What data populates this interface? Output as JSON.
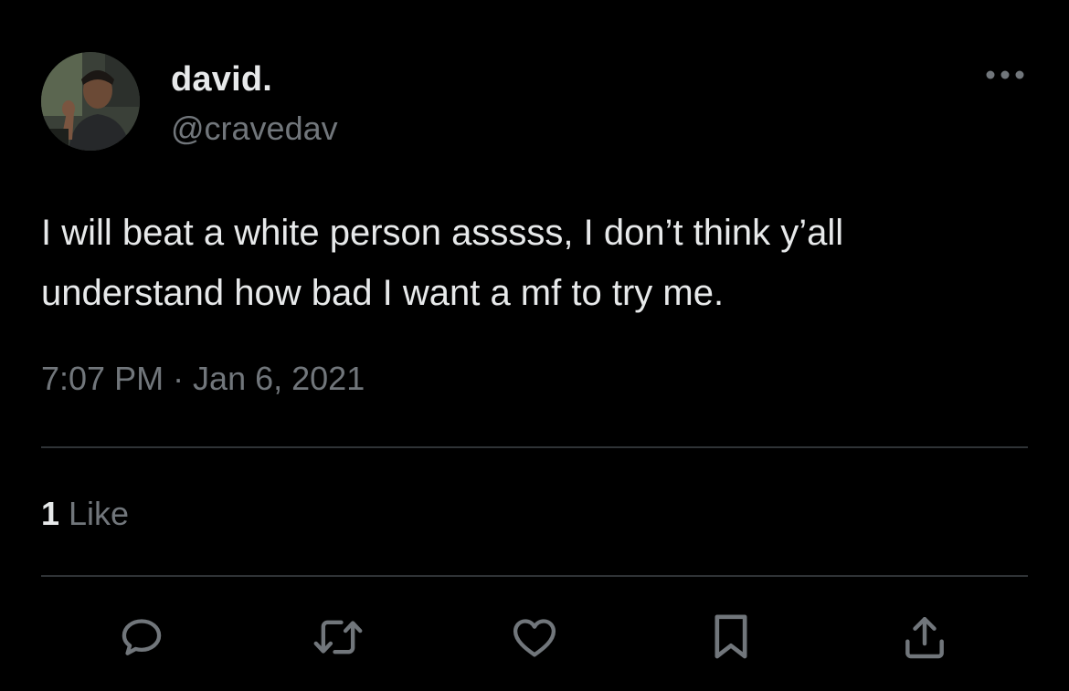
{
  "author": {
    "display_name": "david.",
    "handle": "@cravedav",
    "avatar_icon": "user-photo-avatar"
  },
  "tweet": {
    "text": "I will beat a white person asssss, I don’t think y’all understand how bad I want a mf to try me.",
    "timestamp": "7:07 PM · Jan 6, 2021"
  },
  "stats": {
    "like_count": "1",
    "like_label": " Like"
  },
  "actions": [
    {
      "icon": "reply-icon"
    },
    {
      "icon": "retweet-icon"
    },
    {
      "icon": "like-heart-icon"
    },
    {
      "icon": "bookmark-icon"
    },
    {
      "icon": "share-icon"
    }
  ],
  "colors": {
    "background": "#000000",
    "primary_text": "#e7e9ea",
    "secondary_text": "#71767b",
    "divider": "#2f3336",
    "icon": "#71767b"
  }
}
